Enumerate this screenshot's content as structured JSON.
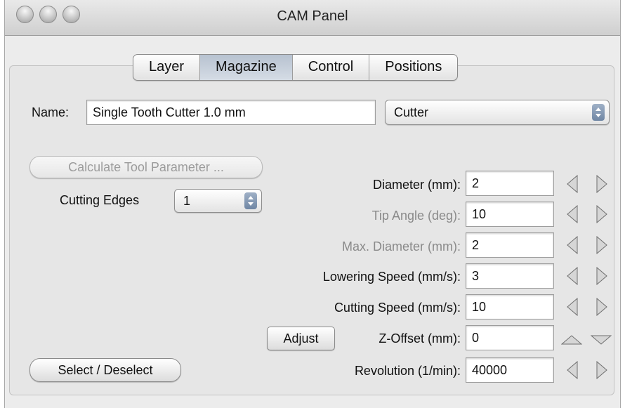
{
  "window": {
    "title": "CAM Panel"
  },
  "tabs": [
    {
      "label": "Layer",
      "active": false
    },
    {
      "label": "Magazine",
      "active": true
    },
    {
      "label": "Control",
      "active": false
    },
    {
      "label": "Positions",
      "active": false
    }
  ],
  "name_row": {
    "label": "Name:",
    "value": "Single Tooth Cutter 1.0 mm",
    "type_select": "Cutter"
  },
  "calc_button": {
    "label": "Calculate Tool Parameter ...",
    "enabled": false
  },
  "cutting_edges": {
    "label": "Cutting Edges",
    "value": "1"
  },
  "parameters": [
    {
      "label": "Diameter (mm):",
      "value": "2",
      "enabled": true,
      "stepper": "left-right"
    },
    {
      "label": "Tip Angle (deg):",
      "value": "10",
      "enabled": false,
      "stepper": "left-right"
    },
    {
      "label": "Max. Diameter (mm):",
      "value": "2",
      "enabled": false,
      "stepper": "left-right"
    },
    {
      "label": "Lowering Speed (mm/s):",
      "value": "3",
      "enabled": true,
      "stepper": "left-right"
    },
    {
      "label": "Cutting Speed (mm/s):",
      "value": "10",
      "enabled": true,
      "stepper": "left-right"
    },
    {
      "label": "Z-Offset (mm):",
      "value": "0",
      "enabled": true,
      "stepper": "up-down"
    },
    {
      "label": "Revolution (1/min):",
      "value": "40000",
      "enabled": true,
      "stepper": "left-right"
    }
  ],
  "adjust_button": {
    "label": "Adjust"
  },
  "select_button": {
    "label": "Select / Deselect"
  },
  "icons": {
    "stepper_left": "triangle-left-icon",
    "stepper_right": "triangle-right-icon",
    "stepper_up": "triangle-up-icon",
    "stepper_down": "triangle-down-icon"
  },
  "colors": {
    "active_tab": "#c4ccd7",
    "disabled_text": "#8a8a8a",
    "popup_arrows": "#7f93ae"
  }
}
